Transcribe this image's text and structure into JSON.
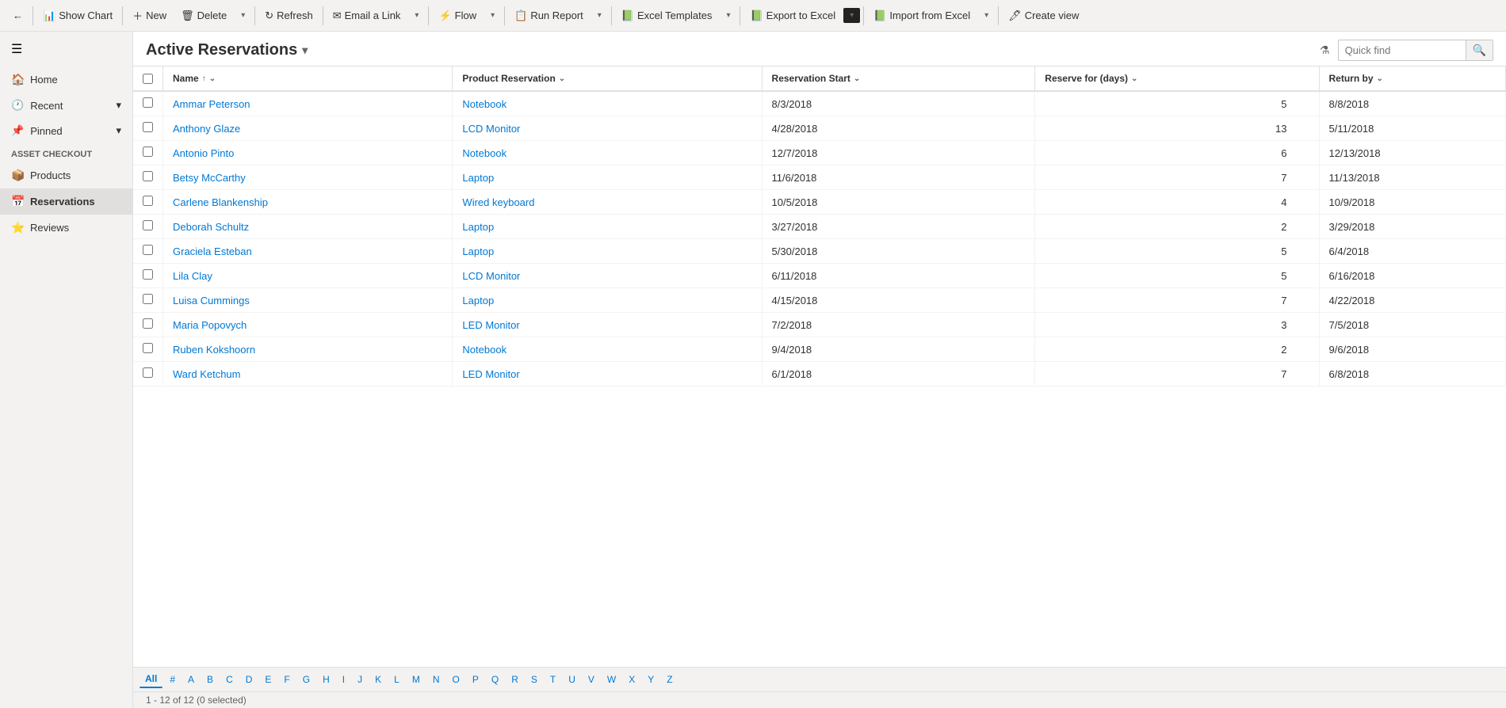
{
  "toolbar": {
    "back_icon": "←",
    "show_chart_label": "Show Chart",
    "new_label": "New",
    "delete_label": "Delete",
    "refresh_label": "Refresh",
    "email_link_label": "Email a Link",
    "flow_label": "Flow",
    "run_report_label": "Run Report",
    "excel_templates_label": "Excel Templates",
    "export_excel_label": "Export to Excel",
    "import_excel_label": "Import from Excel",
    "create_view_label": "Create view"
  },
  "sidebar": {
    "home_label": "Home",
    "recent_label": "Recent",
    "pinned_label": "Pinned",
    "group_label": "Asset Checkout",
    "products_label": "Products",
    "reservations_label": "Reservations",
    "reviews_label": "Reviews"
  },
  "view": {
    "title": "Active Reservations",
    "quick_find_placeholder": "Quick find"
  },
  "table": {
    "columns": [
      {
        "key": "name",
        "label": "Name",
        "sortable": true,
        "sort_dir": "asc"
      },
      {
        "key": "product",
        "label": "Product Reservation",
        "sortable": true
      },
      {
        "key": "start",
        "label": "Reservation Start",
        "sortable": true
      },
      {
        "key": "days",
        "label": "Reserve for (days)",
        "sortable": true
      },
      {
        "key": "return",
        "label": "Return by",
        "sortable": true
      }
    ],
    "rows": [
      {
        "name": "Ammar Peterson",
        "product": "Notebook",
        "start": "8/3/2018",
        "days": "5",
        "return": "8/8/2018"
      },
      {
        "name": "Anthony Glaze",
        "product": "LCD Monitor",
        "start": "4/28/2018",
        "days": "13",
        "return": "5/11/2018"
      },
      {
        "name": "Antonio Pinto",
        "product": "Notebook",
        "start": "12/7/2018",
        "days": "6",
        "return": "12/13/2018"
      },
      {
        "name": "Betsy McCarthy",
        "product": "Laptop",
        "start": "11/6/2018",
        "days": "7",
        "return": "11/13/2018"
      },
      {
        "name": "Carlene Blankenship",
        "product": "Wired keyboard",
        "start": "10/5/2018",
        "days": "4",
        "return": "10/9/2018"
      },
      {
        "name": "Deborah Schultz",
        "product": "Laptop",
        "start": "3/27/2018",
        "days": "2",
        "return": "3/29/2018"
      },
      {
        "name": "Graciela Esteban",
        "product": "Laptop",
        "start": "5/30/2018",
        "days": "5",
        "return": "6/4/2018"
      },
      {
        "name": "Lila Clay",
        "product": "LCD Monitor",
        "start": "6/11/2018",
        "days": "5",
        "return": "6/16/2018"
      },
      {
        "name": "Luisa Cummings",
        "product": "Laptop",
        "start": "4/15/2018",
        "days": "7",
        "return": "4/22/2018"
      },
      {
        "name": "Maria Popovych",
        "product": "LED Monitor",
        "start": "7/2/2018",
        "days": "3",
        "return": "7/5/2018"
      },
      {
        "name": "Ruben Kokshoorn",
        "product": "Notebook",
        "start": "9/4/2018",
        "days": "2",
        "return": "9/6/2018"
      },
      {
        "name": "Ward Ketchum",
        "product": "LED Monitor",
        "start": "6/1/2018",
        "days": "7",
        "return": "6/8/2018"
      }
    ]
  },
  "pagination": {
    "letters": [
      "All",
      "#",
      "A",
      "B",
      "C",
      "D",
      "E",
      "F",
      "G",
      "H",
      "I",
      "J",
      "K",
      "L",
      "M",
      "N",
      "O",
      "P",
      "Q",
      "R",
      "S",
      "T",
      "U",
      "V",
      "W",
      "X",
      "Y",
      "Z"
    ],
    "active": "All"
  },
  "status": {
    "text": "1 - 12 of 12 (0 selected)"
  }
}
